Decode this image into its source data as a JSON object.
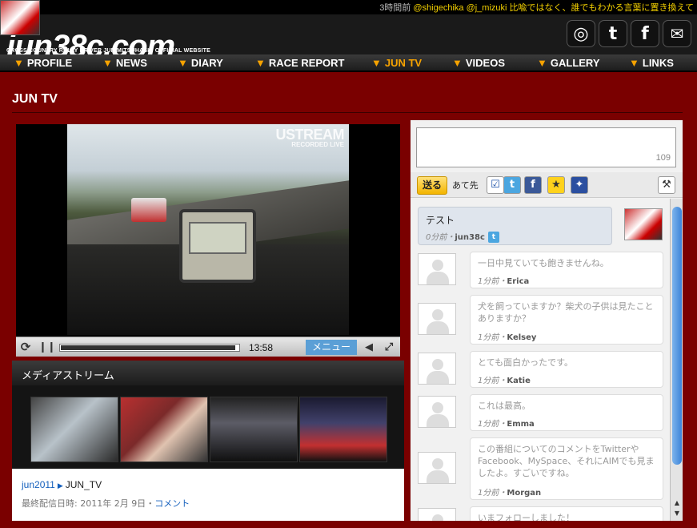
{
  "ticker": {
    "time": "3時間前",
    "users": "@shigechika @j_mizuki",
    "message": "比喩ではなく、誰でもわかる言葉に置き換えて"
  },
  "site": {
    "logo": "jun38c.com",
    "tagline": "CROSS COUNTRY RALLY DRIVER JUN MITSUHASHI OFFICIAL WEBSITE"
  },
  "social_icons": [
    "rss-icon",
    "twitter-icon",
    "facebook-icon",
    "mail-icon"
  ],
  "nav": {
    "items": [
      {
        "label": "PROFILE"
      },
      {
        "label": "NEWS"
      },
      {
        "label": "DIARY"
      },
      {
        "label": "RACE REPORT"
      },
      {
        "label": "JUN TV",
        "active": true
      },
      {
        "label": "VIDEOS"
      },
      {
        "label": "GALLERY"
      },
      {
        "label": "LINKS"
      }
    ],
    "active_color": "#f7a300"
  },
  "page": {
    "title": "JUN TV"
  },
  "player": {
    "watermark": "USTREAM",
    "watermark_sub": "RECORDED LIVE",
    "progress": 0.98,
    "time": "13:58",
    "menu_label": "メニュー"
  },
  "media": {
    "title": "メディアストリーム",
    "user": "jun2011",
    "show": "JUN_TV",
    "last_label": "最終配信日時: 2011年 2月 9日",
    "separator": "・",
    "comment_link": "コメント"
  },
  "social_panel": {
    "char_count": "109",
    "send_label": "送る",
    "dest_label": "あて先",
    "own_message": {
      "text": "テスト",
      "time": "0分前",
      "separator": "・",
      "user": "jun38c"
    },
    "comments": [
      {
        "text": "一日中見ていても飽きませんね。",
        "time": "1分前",
        "user": "Erica"
      },
      {
        "text": "犬を飼っていますか？柴犬の子供は見たことありますか？",
        "time": "1分前",
        "user": "Kelsey"
      },
      {
        "text": "とても面白かったです。",
        "time": "1分前",
        "user": "Katie"
      },
      {
        "text": "これは最高。",
        "time": "1分前",
        "user": "Emma"
      },
      {
        "text": "この番組についてのコメントをTwitterやFacebook、MySpace、それにAIMでも見ましたよ。すごいですね。",
        "time": "1分前",
        "user": "Morgan"
      },
      {
        "text": "いまフォローしました！",
        "time": "",
        "user": ""
      }
    ]
  },
  "colors": {
    "background": "#7a0000",
    "accent": "#f7a300",
    "link": "#1560bd",
    "twitter": "#4ba6e0"
  }
}
